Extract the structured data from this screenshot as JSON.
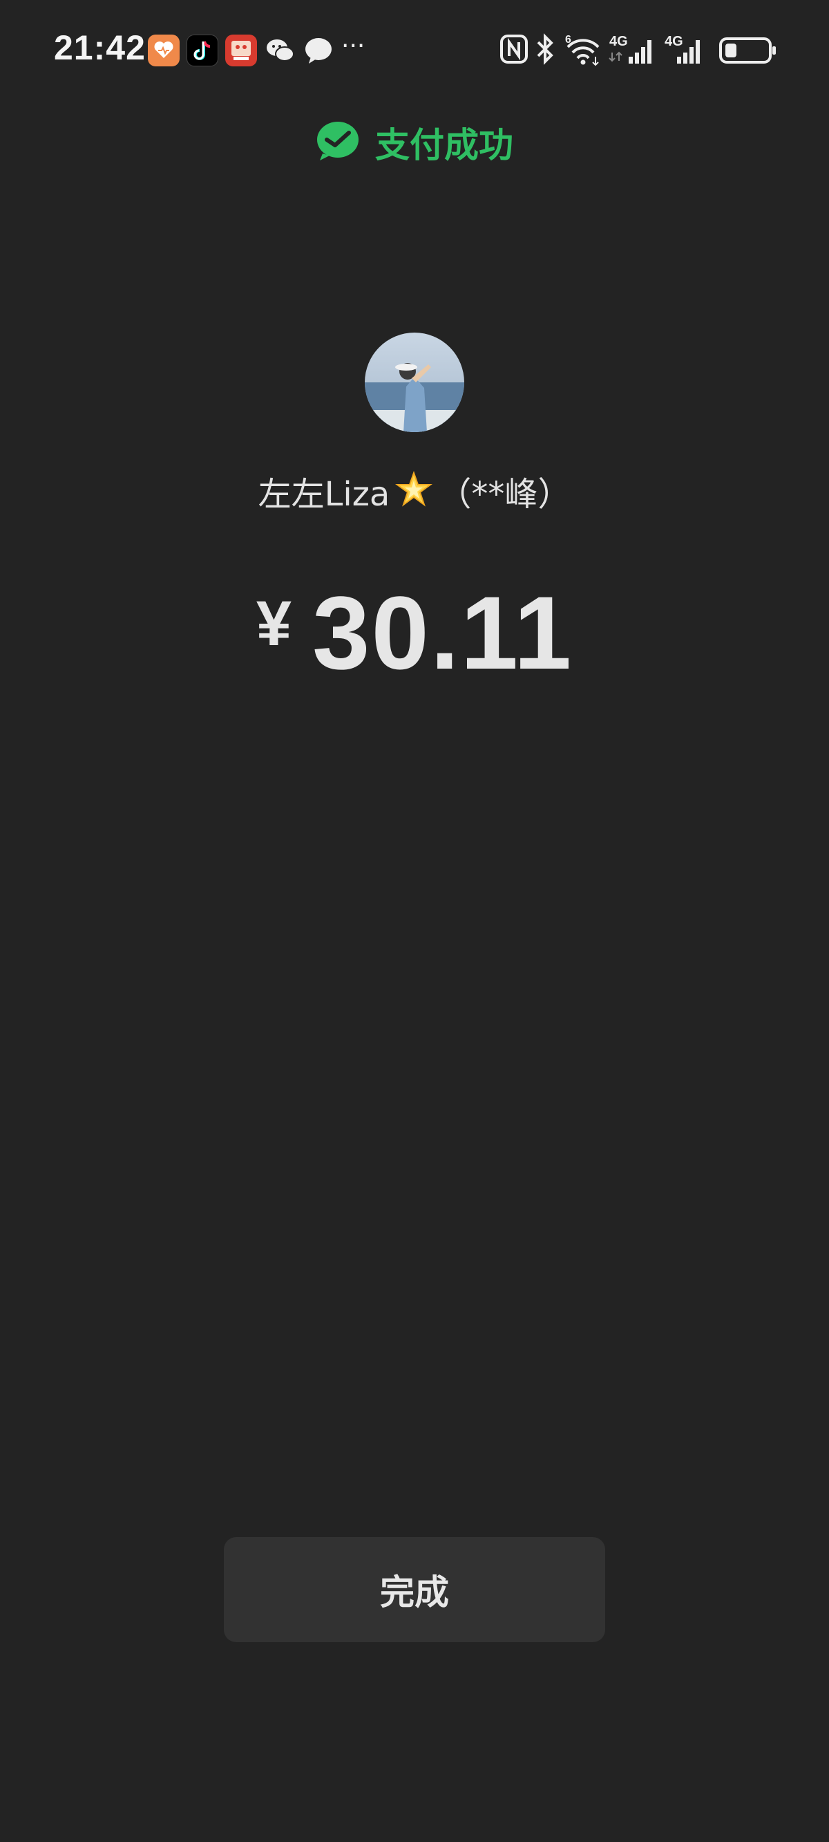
{
  "status_bar": {
    "time": "21:42",
    "more_glyph": "···",
    "notification_icons": [
      "health-app-icon",
      "tiktok-icon",
      "red-app-icon",
      "wechat-icon",
      "message-icon"
    ],
    "system_icons": [
      "nfc-icon",
      "bluetooth-icon",
      "wifi-icon",
      "signal-4g-icon",
      "signal-4g-icon",
      "battery-icon"
    ],
    "wifi_badge": "6",
    "network_label_1": "4G",
    "network_label_2": "4G"
  },
  "header": {
    "title": "支付成功",
    "icon": "check-circle-icon",
    "accent_color": "#2fbf63"
  },
  "payee": {
    "name": "左左Liza",
    "emoji": "🌟",
    "masked_name": "（**峰）"
  },
  "payment": {
    "currency_symbol": "¥",
    "amount": "30.11"
  },
  "actions": {
    "done_label": "完成"
  },
  "theme": {
    "background": "#232323",
    "button_background": "#323232"
  }
}
